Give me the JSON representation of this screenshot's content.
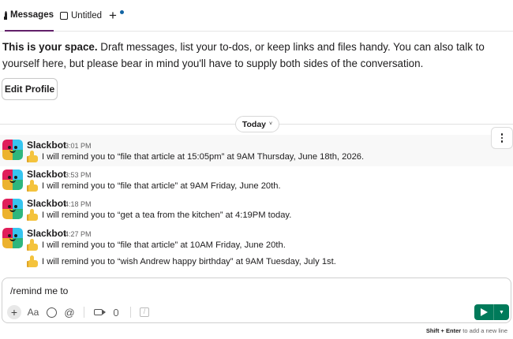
{
  "tabs": {
    "messages": "Messages",
    "untitled": "Untitled",
    "add": "+"
  },
  "intro": {
    "bold": "This is your space.",
    "text": " Draft messages, list your to-dos, or keep links and files handy. You can also talk to yourself here, but please bear in mind you'll have to supply both sides of the conversation."
  },
  "edit_profile": "Edit Profile",
  "day_divider": {
    "label": "Today",
    "chevron": "˅"
  },
  "messages": [
    {
      "sender": "Slackbot",
      "time": "3:01 PM",
      "lines": [
        "I will remind you to “file that article at 15:05pm” at 9AM Thursday, June 18th, 2026."
      ]
    },
    {
      "sender": "Slackbot",
      "time": "3:53 PM",
      "lines": [
        "I will remind you to “file that article” at 9AM Friday, June 20th."
      ]
    },
    {
      "sender": "Slackbot",
      "time": "4:18 PM",
      "lines": [
        "I will remind you to “get a tea from the kitchen” at 4:19PM today."
      ]
    },
    {
      "sender": "Slackbot",
      "time": "4:27 PM",
      "lines": [
        "I will remind you to “file that article” at 10AM Friday, June 20th.",
        "I will remind you to “wish Andrew happy birthday” at 9AM Tuesday, July 1st."
      ]
    }
  ],
  "composer": {
    "value": "/remind me to",
    "format_label": "Aa",
    "mention_label": "@"
  },
  "hint": {
    "keys": "Shift + Enter",
    "text": " to add a new line"
  },
  "colors": {
    "accent_tab": "#611f69",
    "send_button": "#007a5a",
    "notification_dot": "#1264a3"
  },
  "icons": [
    "messages-icon",
    "canvas-icon",
    "plus-icon",
    "more-vertical-icon",
    "thumbs-up-icon",
    "emoji-icon",
    "video-icon",
    "microphone-icon",
    "slash-command-icon",
    "send-icon",
    "chevron-down-icon"
  ]
}
